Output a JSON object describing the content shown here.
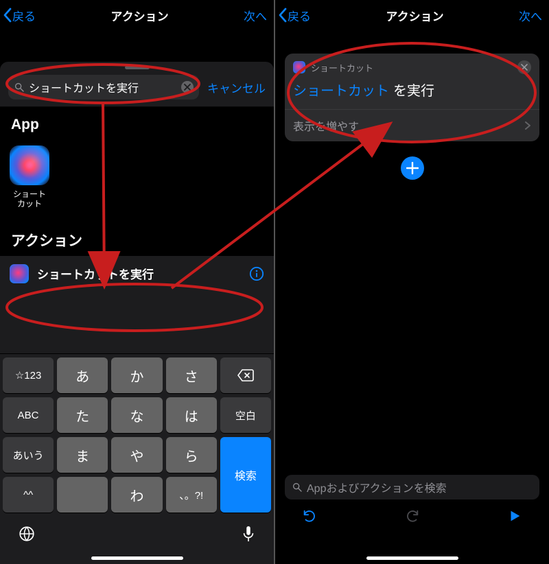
{
  "nav": {
    "back_label": "戻る",
    "title": "アクション",
    "next_label": "次へ"
  },
  "search": {
    "value": "ショートカットを実行",
    "cancel": "キャンセル"
  },
  "sections": {
    "app": "App",
    "actions": "アクション"
  },
  "app_tile": {
    "name_line1": "ショート",
    "name_line2": "カット"
  },
  "action_row": {
    "label": "ショートカットを実行"
  },
  "keyboard": {
    "row1": [
      "☆123",
      "あ",
      "か",
      "さ",
      "⌫"
    ],
    "row2": [
      "ABC",
      "た",
      "な",
      "は",
      "空白"
    ],
    "row3_left": "あいう",
    "row3_keys": [
      "ま",
      "や",
      "ら"
    ],
    "row3_right": "検索",
    "row4_left": "^^",
    "row4_keys": [
      "わ",
      "、。?!"
    ],
    "row4_gap": ""
  },
  "right_card": {
    "header": "ショートカット",
    "variable": "ショートカット",
    "run_text": "を実行",
    "show_more": "表示を増やす"
  },
  "right_search_placeholder": "Appおよびアクションを検索",
  "colors": {
    "accent": "#0a84ff",
    "annotation": "#c81e1e"
  }
}
